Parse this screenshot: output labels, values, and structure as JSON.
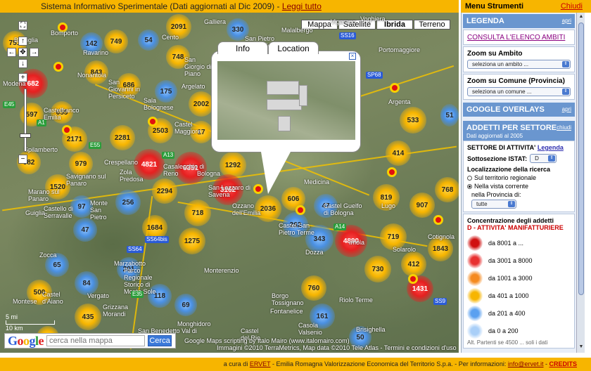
{
  "topbar": {
    "text": "Sistema Informativo Sperimentale (Dati aggiornati al Dic 2009) - ",
    "link": "Leggi tutto"
  },
  "menu": {
    "title": "Menu Strumenti",
    "close": "Chiudi"
  },
  "map_types": [
    "Mappa",
    "Satellite",
    "Ibrida",
    "Terreno"
  ],
  "map_type_selected": "Ibrida",
  "popup": {
    "tabs": [
      "Info",
      "Location"
    ],
    "active_tab": "Location",
    "close_glyph": "×"
  },
  "clusters": [
    {
      "label": "751",
      "color": "yellow"
    },
    {
      "label": "142",
      "color": "blue"
    },
    {
      "label": "749",
      "color": "yellow"
    },
    {
      "label": "54",
      "color": "blue"
    },
    {
      "label": "2091",
      "color": "yellow"
    },
    {
      "label": "330",
      "color": "blue"
    },
    {
      "label": "682",
      "color": "red"
    },
    {
      "label": "843",
      "color": "yellow"
    },
    {
      "label": "686",
      "color": "yellow"
    },
    {
      "label": "748",
      "color": "yellow"
    },
    {
      "label": "175",
      "color": "blue"
    },
    {
      "label": "597",
      "color": "yellow"
    },
    {
      "label": "655",
      "color": "yellow"
    },
    {
      "label": "2281",
      "color": "yellow"
    },
    {
      "label": "2503",
      "color": "yellow"
    },
    {
      "label": "2171",
      "color": "yellow"
    },
    {
      "label": "682",
      "color": "yellow"
    },
    {
      "label": "979",
      "color": "yellow"
    },
    {
      "label": "4821",
      "color": "red"
    },
    {
      "label": "6351",
      "color": "red"
    },
    {
      "label": "1292",
      "color": "yellow"
    },
    {
      "label": "1520",
      "color": "yellow"
    },
    {
      "label": "2294",
      "color": "yellow"
    },
    {
      "label": "3162",
      "color": "red"
    },
    {
      "label": "2036",
      "color": "yellow"
    },
    {
      "label": "606",
      "color": "yellow"
    },
    {
      "label": "47",
      "color": "blue"
    },
    {
      "label": "97",
      "color": "blue"
    },
    {
      "label": "256",
      "color": "blue"
    },
    {
      "label": "718",
      "color": "yellow"
    },
    {
      "label": "47",
      "color": "blue"
    },
    {
      "label": "1684",
      "color": "yellow"
    },
    {
      "label": "1275",
      "color": "yellow"
    },
    {
      "label": "262",
      "color": "blue"
    },
    {
      "label": "343",
      "color": "blue"
    },
    {
      "label": "4890",
      "color": "red"
    },
    {
      "label": "414",
      "color": "yellow"
    },
    {
      "label": "533",
      "color": "yellow"
    },
    {
      "label": "819",
      "color": "yellow"
    },
    {
      "label": "907",
      "color": "yellow"
    },
    {
      "label": "768",
      "color": "yellow"
    },
    {
      "label": "719",
      "color": "yellow"
    },
    {
      "label": "1843",
      "color": "yellow"
    },
    {
      "label": "65",
      "color": "blue"
    },
    {
      "label": "201",
      "color": "blue"
    },
    {
      "label": "84",
      "color": "blue"
    },
    {
      "label": "500",
      "color": "yellow"
    },
    {
      "label": "118",
      "color": "blue"
    },
    {
      "label": "69",
      "color": "blue"
    },
    {
      "label": "730",
      "color": "yellow"
    },
    {
      "label": "412",
      "color": "yellow"
    },
    {
      "label": "1431",
      "color": "red"
    },
    {
      "label": "760",
      "color": "yellow"
    },
    {
      "label": "161",
      "color": "blue"
    },
    {
      "label": "435",
      "color": "yellow"
    },
    {
      "label": "50",
      "color": "blue"
    },
    {
      "label": "501",
      "color": "yellow"
    },
    {
      "label": "51",
      "color": "blue"
    },
    {
      "label": "2002",
      "color": "yellow"
    },
    {
      "label": "17",
      "color": "yellow"
    }
  ],
  "places": [
    "Bastiglia",
    "Bomporto",
    "Modena",
    "Castelfranco Emilia",
    "Spilamberto",
    "Marano sul Panaro",
    "Savignano sul Panaro",
    "Guiglia",
    "Castello di Serravalle",
    "Monte San Pietro",
    "Crespellano",
    "Zola Predosa",
    "Casalecchio di Reno",
    "Bologna",
    "San Lazzaro di Savena",
    "Ozzano dell'Emilia",
    "Castel San Pietro Terme",
    "Medicina",
    "Dozza",
    "Imola",
    "Castel Guelfo di Bologna",
    "Argenta",
    "Portomaggiore",
    "Lugo",
    "Solarolo",
    "Cotignola",
    "Marzabotto",
    "Parco Regionale Storico di Monte Sole",
    "Vergato",
    "Grizzana Morandi",
    "Monterenzio",
    "Borgo Tossignano",
    "Riolo Terme",
    "Fontanelice",
    "Casola Valsenio",
    "Brisighella",
    "Castel del Rio",
    "San Benedetto Val di Sambro",
    "Monghidoro",
    "Zocca",
    "Montese",
    "Castel d'Aiano",
    "Sala Bolognese",
    "Castel Maggiore",
    "Argelato",
    "San Giorgio di Piano",
    "Cento",
    "Galliera",
    "San Pietro in Casale",
    "Malalbergo",
    "Vigarano",
    "Voghiera",
    "Ravarino",
    "Nonantola",
    "San Giovanni in Persiceto"
  ],
  "road_shields": [
    "E45",
    "SS9",
    "A1",
    "A14",
    "E35",
    "SS64",
    "SS64bis",
    "SS16",
    "SP68",
    "A13",
    "E55"
  ],
  "scale": {
    "top": "5 mi",
    "bottom": "10 km"
  },
  "search": {
    "placeholder": "cerca nella mappa",
    "button": "Cerca",
    "logo": "Google"
  },
  "credits": {
    "line1": "Google Maps scripting by Italo Mairo (www.italomairo.com)",
    "line2": "Immagini ©2010 TerraMetrics, Map data ©2010 Tele Atlas - Termini e condizioni d'uso"
  },
  "sidebar": {
    "legenda": {
      "title": "LEGENDA",
      "toggle": "apri"
    },
    "consulta": "CONSULTA L'ELENCO AMBITI",
    "zoom_ambito": {
      "label": "Zoom su Ambito",
      "value": "seleziona un ambito ..."
    },
    "zoom_comune": {
      "label": "Zoom su Comune (Provincia)",
      "value": "seleziona un comune ..."
    },
    "overlays": {
      "title": "GOOGLE OVERLAYS",
      "toggle": "apri"
    },
    "addetti": {
      "title": "ADDETTI PER SETTORE",
      "toggle": "chiudi",
      "subtitle": "Dati aggiornati al 2005",
      "settore_label": "SETTORE DI ATTIVITA'",
      "settore_link": "Legenda",
      "sottosezione_label": "Sottosezione ISTAT:",
      "sottosezione_value": "D",
      "localizzazione_label": "Localizzazione della ricerca",
      "opt1": "Sul territorio regionale",
      "opt2": "Nella vista corrente",
      "provincia_label": "nella Provincia di:",
      "provincia_value": "tutte"
    },
    "concentrazione": {
      "title": "Concentrazione degli addetti",
      "subtitle": "D - ATTIVITA' MANIFATTURIERE",
      "legend": [
        {
          "label": "da 8001 a ...",
          "color": "#d01010"
        },
        {
          "label": "da 3001 a 8000",
          "color": "#e83030"
        },
        {
          "label": "da 1001 a 3000",
          "color": "#f58a1f"
        },
        {
          "label": "da 401 a 1000",
          "color": "#f7b500"
        },
        {
          "label": "da 201 a 400",
          "color": "#5aa0f0"
        },
        {
          "label": "da 0 a 200",
          "color": "#a9cff8"
        }
      ],
      "overflow_text": "Alt. Partenti se 4500 ... soli i dati"
    }
  },
  "footer": {
    "prefix": "a cura di ",
    "ervet": "ERVET",
    "middle": " - Emilia Romagna Valorizzazione Economica del Territorio S.p.a. - Per informazioni: ",
    "email": "info@ervet.it",
    "sep": " - ",
    "credits": "CREDITS"
  }
}
